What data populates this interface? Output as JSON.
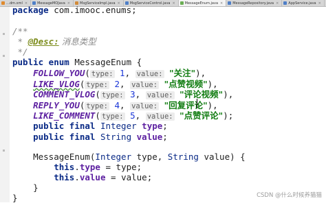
{
  "tabs": [
    {
      "label": "…dm.xml",
      "color": "#e08a2e",
      "active": false
    },
    {
      "label": "MessageMOJava",
      "color": "#4f7fc7",
      "active": false
    },
    {
      "label": "MsgServiceImpl.java",
      "color": "#d18b3a",
      "active": false
    },
    {
      "label": "MsgServiceControl.java",
      "color": "#4f7fc7",
      "active": false
    },
    {
      "label": "MessageEnum.java",
      "color": "#6bae54",
      "active": true
    },
    {
      "label": "MessageRepository.java",
      "color": "#4f7fc7",
      "active": false
    },
    {
      "label": "AppService.java",
      "color": "#4f7fc7",
      "active": false
    }
  ],
  "code": {
    "package_kw": "package",
    "package_name": " com.imooc.enums;",
    "doc_open": "/**",
    "doc_star": " * ",
    "doc_tag": "@Desc:",
    "doc_text": " 消息类型",
    "doc_close": " */",
    "enum_decl_kw": "public enum",
    "enum_decl_name": " MessageEnum {",
    "constants": [
      {
        "name": "FOLLOW_YOU",
        "type_hint": "type:",
        "num": "1",
        "value_hint": "value:",
        "value": "\"关注\"",
        "end": "),",
        "wavy": false
      },
      {
        "name": "LIKE_VLOG",
        "type_hint": "type:",
        "num": "2",
        "value_hint": "value:",
        "value": "\"点赞视频\"",
        "end": "),",
        "wavy": true
      },
      {
        "name": "COMMENT_VLOG",
        "type_hint": "type:",
        "num": "3",
        "value_hint": "value:",
        "value": "\"评论视频\"",
        "end": "),",
        "wavy": false
      },
      {
        "name": "REPLY_YOU",
        "type_hint": "type:",
        "num": "4",
        "value_hint": "value:",
        "value": "\"回复评论\"",
        "end": "),",
        "wavy": false
      },
      {
        "name": "LIKE_COMMENT",
        "type_hint": "type:",
        "num": "5",
        "value_hint": "value:",
        "value": "\"点赞评论\"",
        "end": ");",
        "wavy": false
      }
    ],
    "field1_kw": "public final",
    "field1_type": " Integer",
    "field1_name": "type",
    "field2_kw": "public final",
    "field2_type": " String",
    "field2_name": "value",
    "ctor_name": "MessageEnum(",
    "ctor_p1_type": "Integer",
    "ctor_p1_name": " type, ",
    "ctor_p2_type": "String",
    "ctor_p2_name": " value) {",
    "assign1_this": "this",
    "assign1_field": "type",
    "assign1_rest": " = type;",
    "assign2_this": "this",
    "assign2_field": "value",
    "assign2_rest": " = value;",
    "close_inner": "}",
    "close_outer": "}"
  },
  "watermark": "CSDN @什么时候养猫猫"
}
